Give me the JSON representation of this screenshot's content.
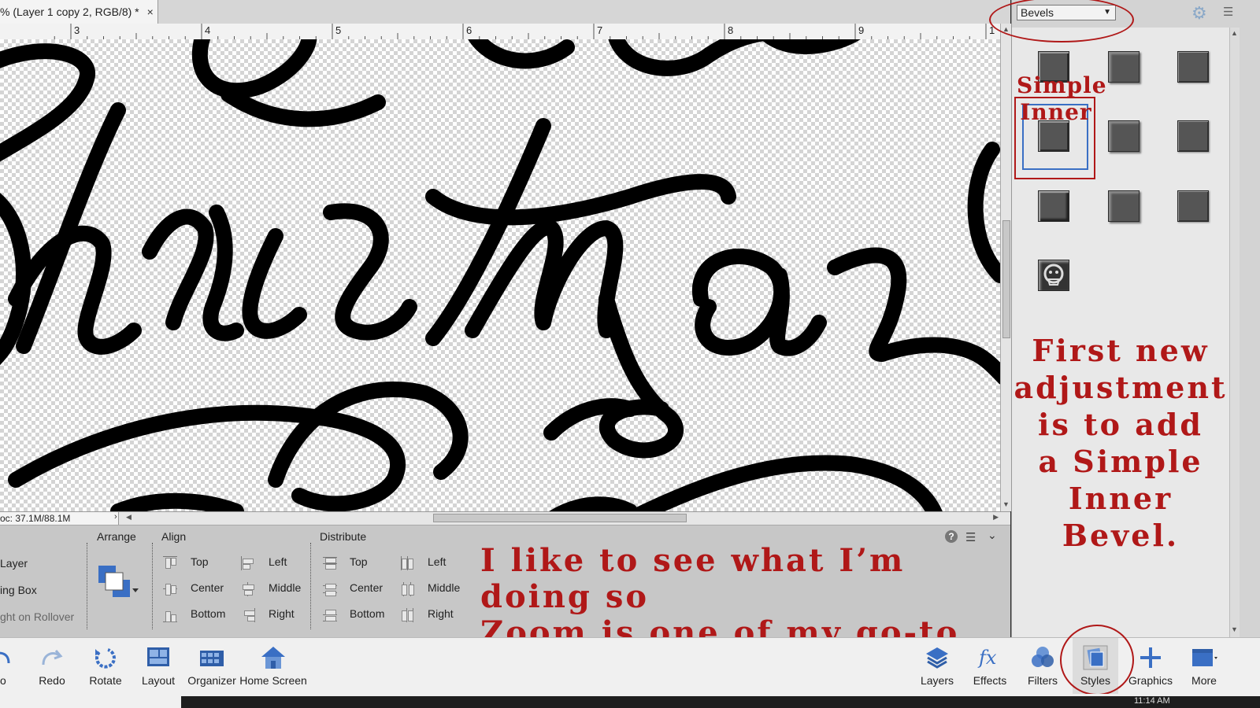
{
  "document": {
    "tab_title": "% (Layer 1 copy 2, RGB/8) *",
    "close_glyph": "×"
  },
  "ruler": {
    "numbers": [
      "3",
      "4",
      "5",
      "6",
      "7",
      "8",
      "9",
      "1"
    ]
  },
  "canvas": {
    "content": "Christmas"
  },
  "status": {
    "doc_size": "oc: 37.1M/88.1M",
    "arrow": "›"
  },
  "options": {
    "left_items": [
      "Layer",
      "ing Box",
      "ght on Rollover"
    ],
    "arrange": {
      "heading": "Arrange"
    },
    "align": {
      "heading": "Align",
      "col1": [
        "Top",
        "Center",
        "Bottom"
      ],
      "col2": [
        "Left",
        "Middle",
        "Right"
      ]
    },
    "distribute": {
      "heading": "Distribute",
      "col1": [
        "Top",
        "Center",
        "Bottom"
      ],
      "col2": [
        "Left",
        "Middle",
        "Right"
      ]
    },
    "help_glyph": "?"
  },
  "annotations": {
    "zoom_note": [
      "I like to see what I’m doing so",
      "Zoom is one of my go-to tools."
    ],
    "bevel_label": [
      "Simple",
      "Inner"
    ],
    "adjust_note": [
      "First new",
      "adjustment",
      "is to add",
      "a Simple",
      "Inner Bevel."
    ],
    "color": "#b01818"
  },
  "styles_panel": {
    "category": "Bevels",
    "selected_style": "Simple Inner"
  },
  "taskbar": {
    "left": [
      "do",
      "Redo",
      "Rotate",
      "Layout",
      "Organizer",
      "Home Screen"
    ],
    "right": [
      "Layers",
      "Effects",
      "Filters",
      "Styles",
      "Graphics",
      "More"
    ]
  },
  "clock": "11:14 AM",
  "colors": {
    "accent_blue": "#3a6fc4",
    "panel_gray": "#c7c7c7"
  }
}
